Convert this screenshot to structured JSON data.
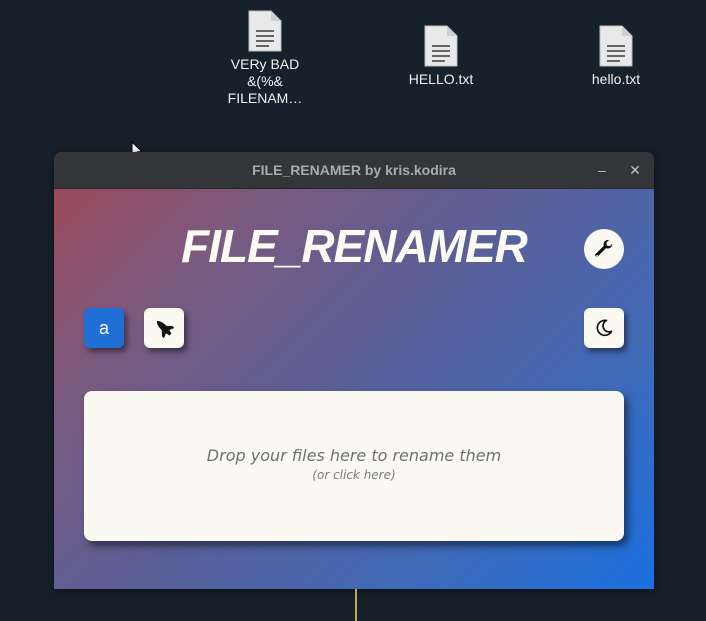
{
  "desktop": {
    "icons": [
      {
        "label": "VERy BAD\n&(%&\nFILENAM…",
        "icon": "text-file-icon"
      },
      {
        "label": "HELLO.txt",
        "icon": "text-file-icon"
      },
      {
        "label": "hello.txt",
        "icon": "text-file-icon"
      }
    ]
  },
  "window": {
    "title": "FILE_RENAMER by kris.kodira",
    "minimize_label": "–",
    "close_label": "✕"
  },
  "app": {
    "heading": "FILE_RENAMER",
    "settings_icon": "wrench-icon",
    "case_button_label": "a",
    "launch_icon": "space-shuttle-icon",
    "theme_icon": "moon-icon",
    "dropzone": {
      "main_text": "Drop your files here to rename them",
      "sub_text": "(or click here)"
    }
  },
  "colors": {
    "desktop_bg": "#17212b",
    "gradient_start": "#9c4a5c",
    "gradient_end": "#1a70e0",
    "case_button": "#1f6fd6",
    "panel": "#fbfaf2"
  }
}
